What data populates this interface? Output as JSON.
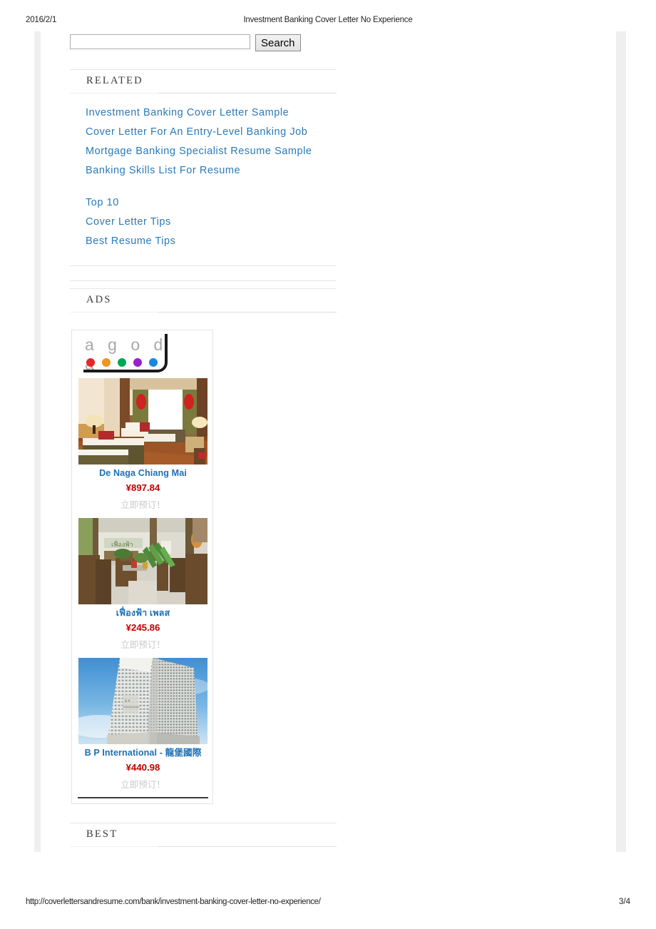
{
  "print": {
    "date": "2016/2/1",
    "title": "Investment Banking Cover Letter No Experience",
    "url": "http://coverlettersandresume.com/bank/investment-banking-cover-letter-no-experience/",
    "page": "3/4"
  },
  "search": {
    "value": "",
    "placeholder": "",
    "button_label": "Search"
  },
  "sections": {
    "related": {
      "heading": "RELATED",
      "group1": [
        {
          "label": "Investment Banking Cover Letter Sample"
        },
        {
          "label": "Cover Letter For An Entry-Level Banking Job"
        },
        {
          "label": "Mortgage Banking Specialist Resume Sample"
        },
        {
          "label": "Banking Skills List For Resume"
        }
      ],
      "group2": [
        {
          "label": "Top 10"
        },
        {
          "label": "Cover Letter Tips"
        },
        {
          "label": "Best Resume Tips"
        }
      ]
    },
    "ads": {
      "heading": "ADS"
    },
    "best": {
      "heading": "BEST"
    }
  },
  "ad_widget": {
    "brand": "agoda",
    "brand_letters": "a g o d a",
    "dot_colors": [
      "#e8262a",
      "#f0941e",
      "#00a651",
      "#9b1fc9",
      "#1b87d8"
    ],
    "hotels": [
      {
        "name": "De Naga Chiang Mai",
        "price": "¥897.84",
        "cta": "立即预订！",
        "photo": "hotel-room-thai-interior"
      },
      {
        "name": "เฟื่องฟ้า เพลส",
        "price": "¥245.86",
        "cta": "立即预订！",
        "photo": "garden-restaurant-patio"
      },
      {
        "name": "B P International - 龍堡國際",
        "price": "¥440.98",
        "cta": "立即预订！",
        "photo": "highrise-hotel-tower"
      }
    ]
  },
  "colors": {
    "link": "#2a7ab9",
    "hotel_name": "#1c6fb5",
    "price": "#c00000",
    "cta": "#c9c9c9",
    "rule": "#e6e6e6",
    "frame_bar": "#efefef"
  }
}
